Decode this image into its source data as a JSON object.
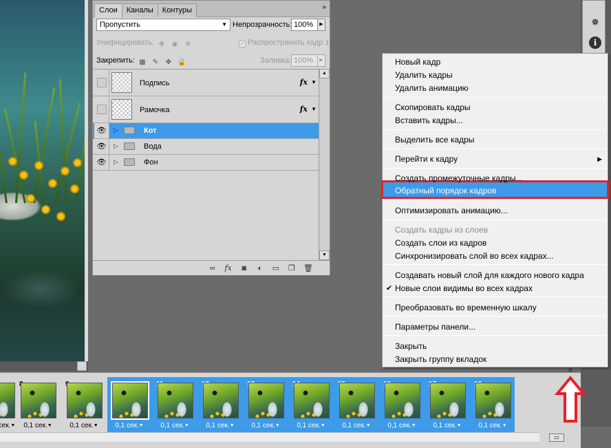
{
  "layers_panel": {
    "tabs": [
      {
        "label": "Слои",
        "active": true
      },
      {
        "label": "Каналы",
        "active": false
      },
      {
        "label": "Контуры",
        "active": false
      }
    ],
    "close_glyph": "»",
    "menu_glyph": "▾≡",
    "blend_mode": "Пропустить",
    "opacity_label": "Непрозрачность:",
    "opacity_value": "100%",
    "unify_label": "Унифицировать:",
    "propagate_label": "Распространить кадр 1",
    "lock_label": "Закрепить:",
    "fill_label": "Заливка:",
    "fill_value": "100%",
    "layers": [
      {
        "name": "Подпись",
        "type": "layer",
        "visible": false,
        "has_fx": true,
        "selected": false
      },
      {
        "name": "Рамочка",
        "type": "layer",
        "visible": false,
        "has_fx": true,
        "selected": false
      },
      {
        "name": "Кот",
        "type": "group",
        "visible": true,
        "selected": true
      },
      {
        "name": "Вода",
        "type": "group",
        "visible": true,
        "selected": false
      },
      {
        "name": "Фон",
        "type": "group",
        "visible": true,
        "selected": false
      }
    ],
    "fx_label": "fx"
  },
  "context_menu": {
    "items": [
      {
        "label": "Новый кадр",
        "enabled": true
      },
      {
        "label": "Удалить кадры",
        "enabled": true
      },
      {
        "label": "Удалить анимацию",
        "enabled": true
      },
      {
        "label": "Скопировать кадры",
        "enabled": true
      },
      {
        "label": "Вставить кадры...",
        "enabled": true
      },
      {
        "label": "Выделить все кадры",
        "enabled": true
      },
      {
        "label": "Перейти к кадру",
        "enabled": true,
        "submenu": true
      },
      {
        "label": "Создать промежуточные кадры...",
        "enabled": true
      },
      {
        "label": "Обратный порядок кадров",
        "enabled": true,
        "highlighted": true
      },
      {
        "label": "Оптимизировать анимацию...",
        "enabled": true
      },
      {
        "label": "Создать кадры из слоев",
        "enabled": false
      },
      {
        "label": "Создать слои из кадров",
        "enabled": true
      },
      {
        "label": "Синхронизировать слой во всех кадрах...",
        "enabled": true
      },
      {
        "label": "Создавать новый слой для каждого нового кадра",
        "enabled": true
      },
      {
        "label": "Новые слои видимы во всех кадрах",
        "enabled": true,
        "checked": true
      },
      {
        "label": "Преобразовать во временную шкалу",
        "enabled": true
      },
      {
        "label": "Параметры панели...",
        "enabled": true
      },
      {
        "label": "Закрыть",
        "enabled": true
      },
      {
        "label": "Закрыть группу вкладок",
        "enabled": true
      }
    ],
    "check_glyph": "✔",
    "submenu_glyph": "▶"
  },
  "animation": {
    "frames": [
      {
        "number": "",
        "duration": "",
        "selected": false
      },
      {
        "number": "8",
        "duration": "0,1 сек.",
        "selected": false
      },
      {
        "number": "9",
        "duration": "0,1 сек.",
        "selected": false
      },
      {
        "number": "10",
        "duration": "0,1 сек.",
        "selected": true,
        "current": true
      },
      {
        "number": "11",
        "duration": "0,1 сек.",
        "selected": true
      },
      {
        "number": "12",
        "duration": "0,1 сек.",
        "selected": true
      },
      {
        "number": "13",
        "duration": "0,1 сек.",
        "selected": true
      },
      {
        "number": "14",
        "duration": "0,1 сек.",
        "selected": true
      },
      {
        "number": "15",
        "duration": "0,1 сек.",
        "selected": true
      },
      {
        "number": "16",
        "duration": "0,1 сек.",
        "selected": true
      },
      {
        "number": "17",
        "duration": "0,1 сек.",
        "selected": true
      },
      {
        "number": "18",
        "duration": "0,1 сек.",
        "selected": true
      }
    ],
    "first_partial_duration": "сек.",
    "panel_menu_glyph": "≡"
  },
  "colors": {
    "selection_blue": "#3d9bea",
    "annotation_red": "#e8202a"
  }
}
